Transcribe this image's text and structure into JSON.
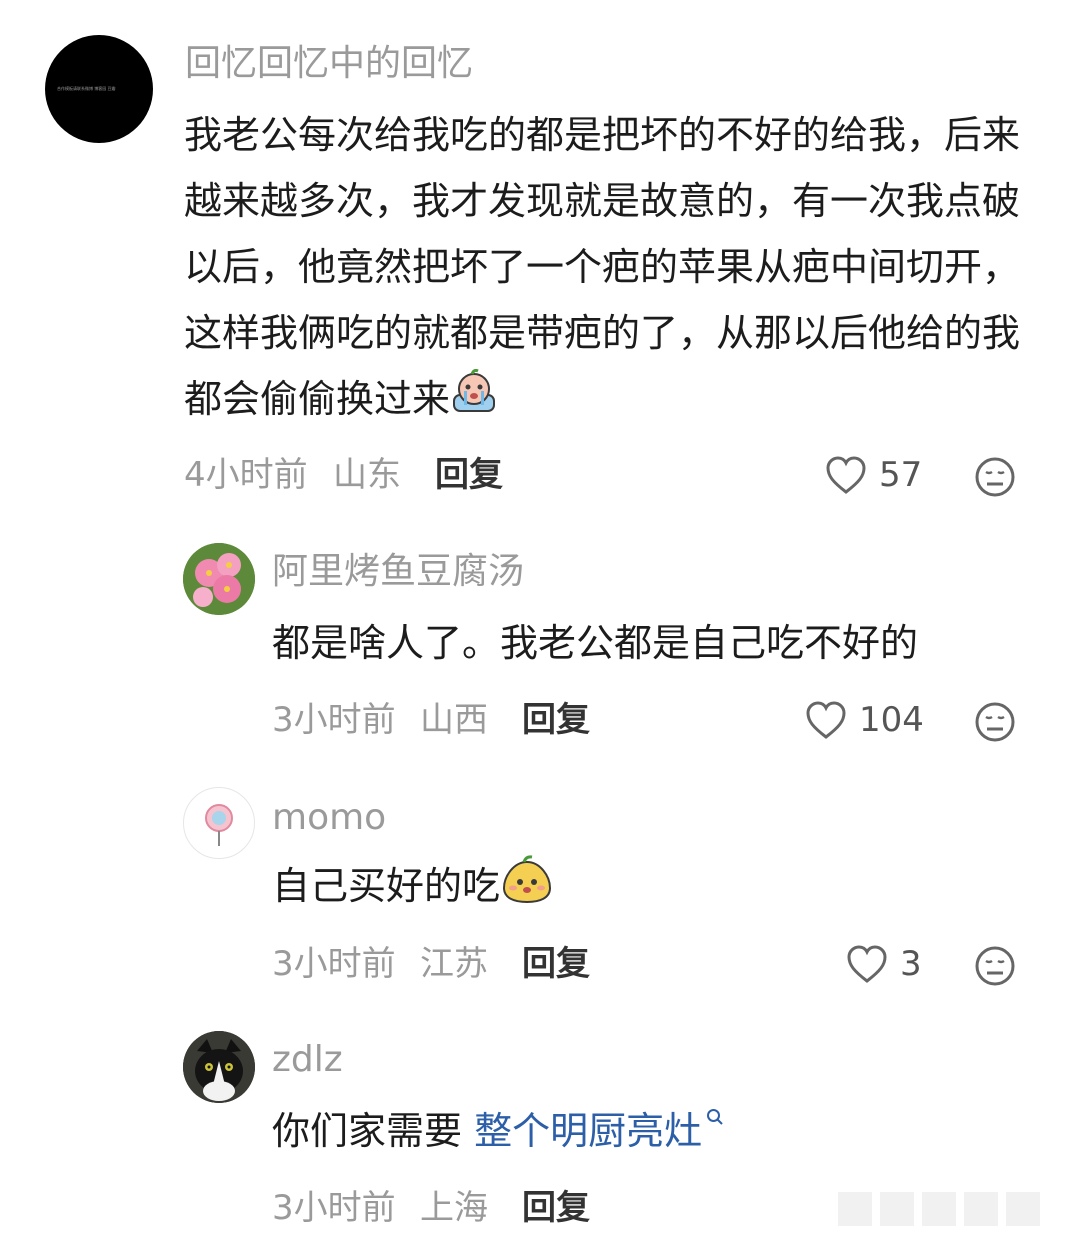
{
  "comments": [
    {
      "username": "回忆回忆中的回忆",
      "text": "我老公每次给我吃的都是把坏的不好的给我，后来越来越多次，我才发现就是故意的，有一次我点破以后，他竟然把坏了一个疤的苹果从疤中间切开，这样我俩吃的就都是带疤的了，从那以后他给的我都会偷偷换过来",
      "time": "4小时前",
      "location": "山东",
      "reply_label": "回复",
      "likes": "57",
      "avatar_text": "合作模板请联系微博 博客园 豆瓣"
    },
    {
      "username": "阿里烤鱼豆腐汤",
      "text": "都是啥人了。我老公都是自己吃不好的",
      "time": "3小时前",
      "location": "山西",
      "reply_label": "回复",
      "likes": "104"
    },
    {
      "username": "momo",
      "text": "自己买好的吃",
      "time": "3小时前",
      "location": "江苏",
      "reply_label": "回复",
      "likes": "3"
    },
    {
      "username": "zdlz",
      "text_prefix": "你们家需要 ",
      "text_link": "整个明厨亮灶",
      "time": "3小时前",
      "location": "上海",
      "reply_label": "回复"
    }
  ],
  "icons": {
    "like": "heart-outline-icon",
    "react": "neutral-face-icon",
    "search": "search-icon",
    "sticker": "crying-sticker-icon",
    "sticker2": "yellow-blob-sticker-icon"
  },
  "colors": {
    "meta_gray": "#9a9a9a",
    "link_blue": "#2c5fa8"
  }
}
